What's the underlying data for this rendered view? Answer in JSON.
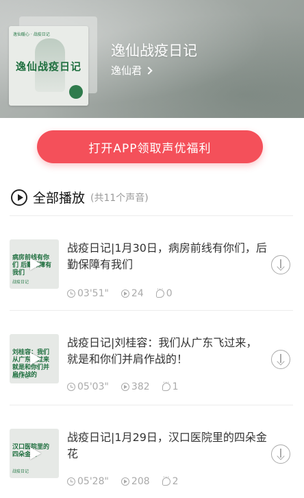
{
  "album": {
    "title": "逸仙战疫日记",
    "author": "逸仙君",
    "cover_title": "逸仙战疫日记",
    "cover_tag": "逸仙暖心 · 战疫日记"
  },
  "cta": {
    "label": "打开APP领取声优福利"
  },
  "playall": {
    "label": "全部播放",
    "count": "(共11个声音)"
  },
  "tracks": [
    {
      "title": "战疫日记|1月30日，病房前线有你们，后勤保障有我们",
      "duration": "03'51\"",
      "plays": "24",
      "comments": "0",
      "thumb_text": "病房前线有你们 后勤保障有我们",
      "thumb_foot": "战疫日记"
    },
    {
      "title": "战疫日记|刘桂容：我们从广东飞过来，就是和你们并肩作战的！",
      "duration": "05'03\"",
      "plays": "382",
      "comments": "1",
      "thumb_text": "刘桂容：我们从广东飞过来 就是和你们并肩作战的",
      "thumb_foot": "战疫日记"
    },
    {
      "title": "战疫日记|1月29日，汉口医院里的四朵金花",
      "duration": "05'28\"",
      "plays": "208",
      "comments": "2",
      "thumb_text": "汉口医院里的四朵金花",
      "thumb_foot": "战疫日记"
    }
  ],
  "colors": {
    "accent": "#f4505a",
    "brand_green": "#1f6f3f"
  }
}
